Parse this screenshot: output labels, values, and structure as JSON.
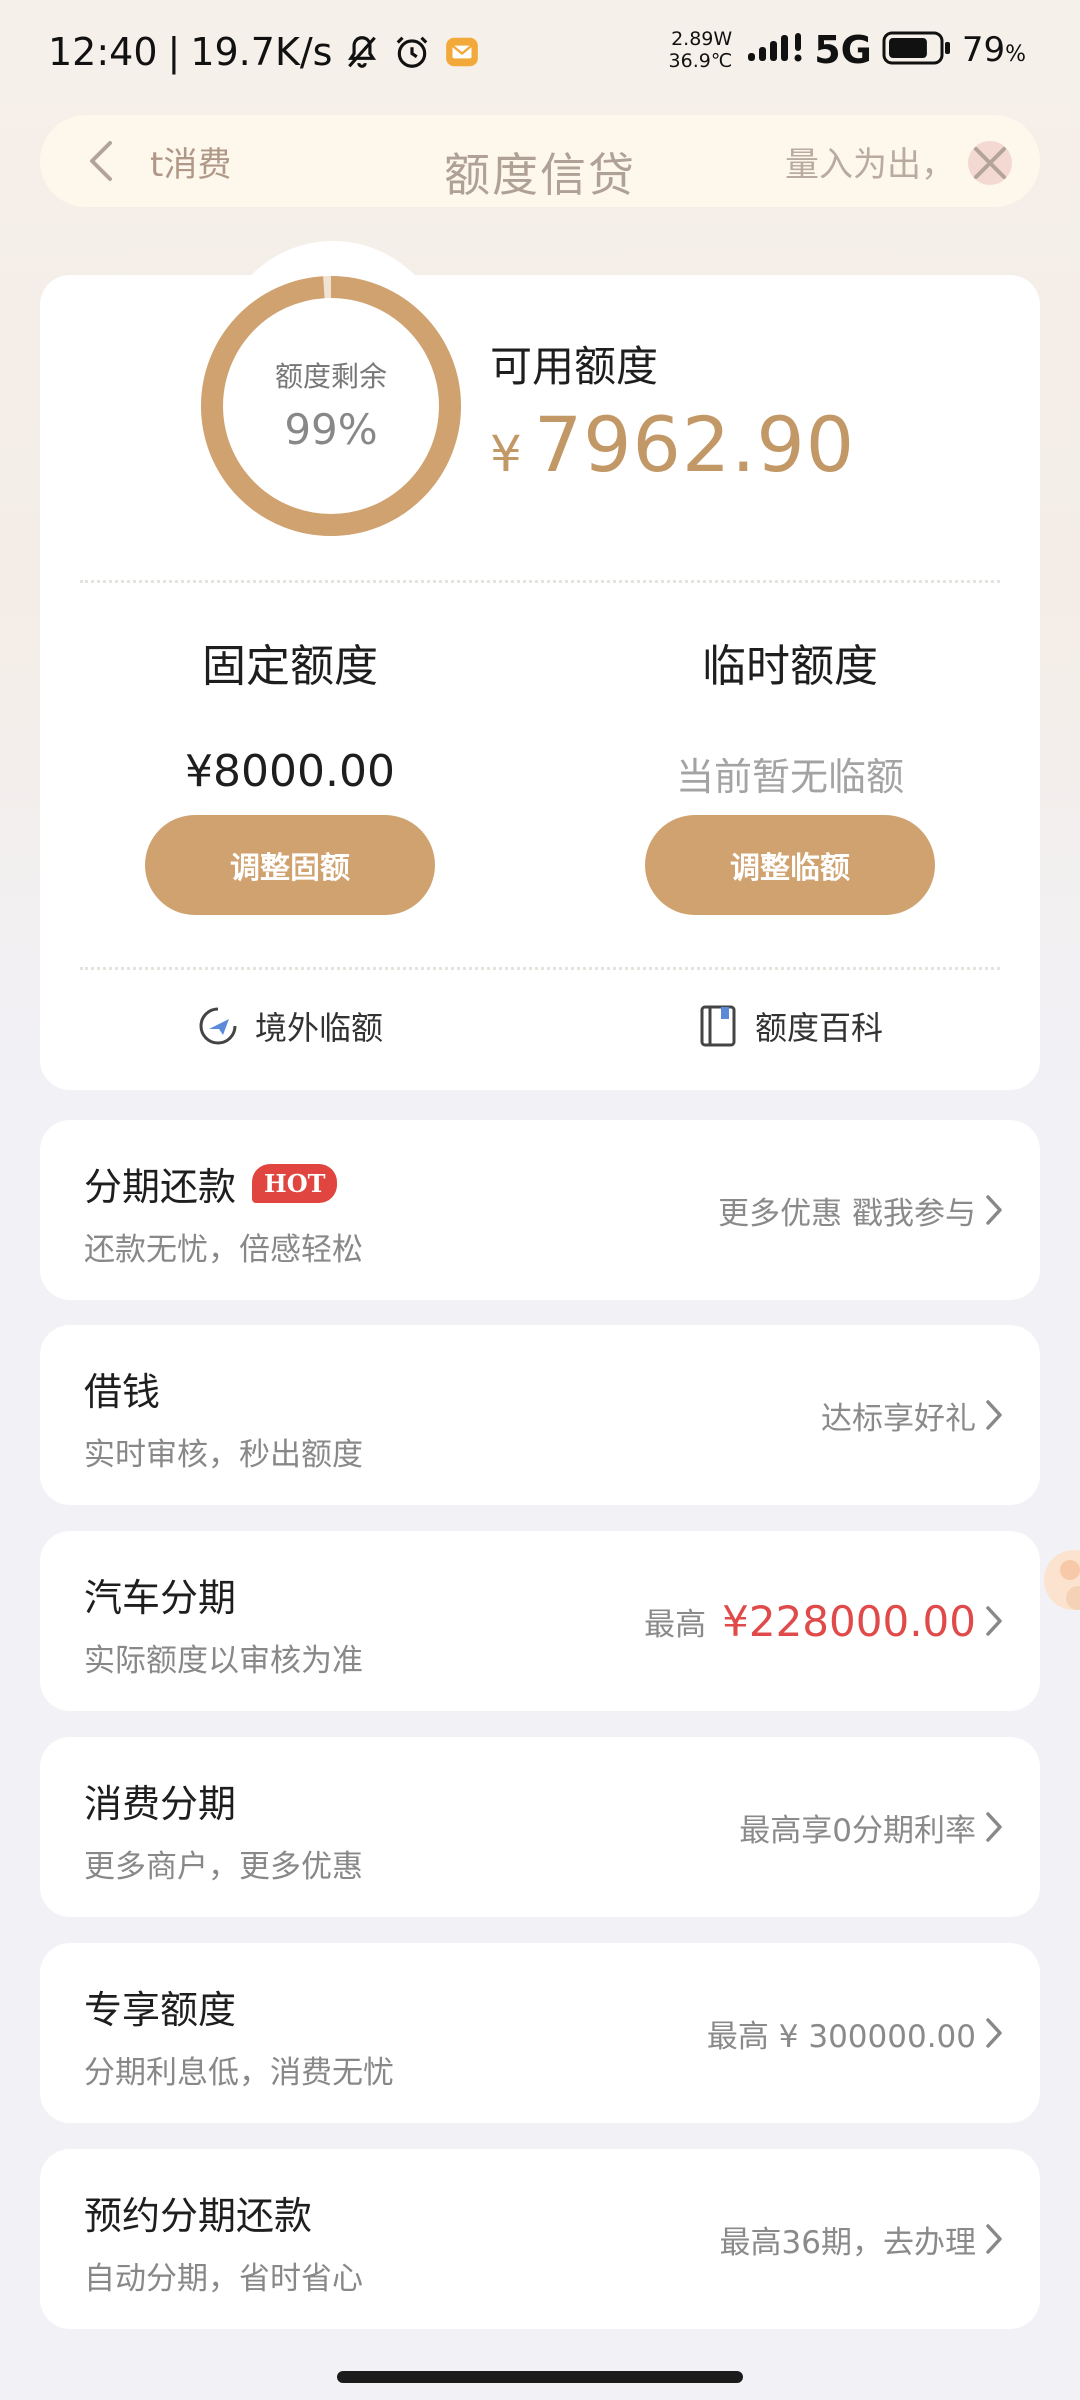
{
  "status_bar": {
    "time": "12:40",
    "net_speed": "19.7K/s",
    "power": "2.89W",
    "temperature": "36.9℃",
    "network": "5G",
    "battery_percent": "79",
    "battery_unit": "%",
    "battery_level": 0.79
  },
  "header": {
    "title": "额度信贷",
    "marquee_left": "t消费",
    "marquee_right": "量入为出，"
  },
  "credit": {
    "ring_label": "额度剩余",
    "ring_percent": "99%",
    "ring_fraction": 0.99,
    "available_label": "可用额度",
    "currency": "¥",
    "available_amount": "7962.90",
    "fixed_label": "固定额度",
    "fixed_amount": "¥8000.00",
    "fixed_button": "调整固额",
    "temp_label": "临时额度",
    "temp_value": "当前暂无临额",
    "temp_button": "调整临额",
    "overseas_label": "境外临额",
    "wiki_label": "额度百科"
  },
  "menu": [
    {
      "title": "分期还款",
      "badge": "HOT",
      "subtitle": "还款无忧，倍感轻松",
      "right_text": "更多优惠 戳我参与"
    },
    {
      "title": "借钱",
      "subtitle": "实时审核，秒出额度",
      "right_text": "达标享好礼"
    },
    {
      "title": "汽车分期",
      "subtitle": "实际额度以审核为准",
      "right_text": "最高",
      "right_highlight": "¥228000.00"
    },
    {
      "title": "消费分期",
      "subtitle": "更多商户，更多优惠",
      "right_text": "最高享0分期利率"
    },
    {
      "title": "专享额度",
      "subtitle": "分期利息低，消费无忧",
      "right_text": "最高 ¥ 300000.00"
    },
    {
      "title": "预约分期还款",
      "subtitle": "自动分期，省时省心",
      "right_text": "最高36期，去办理"
    }
  ],
  "colors": {
    "accent": "#cfa26f",
    "amount": "#c29867",
    "hot": "#e0463f",
    "highlight": "#e04a4a"
  }
}
